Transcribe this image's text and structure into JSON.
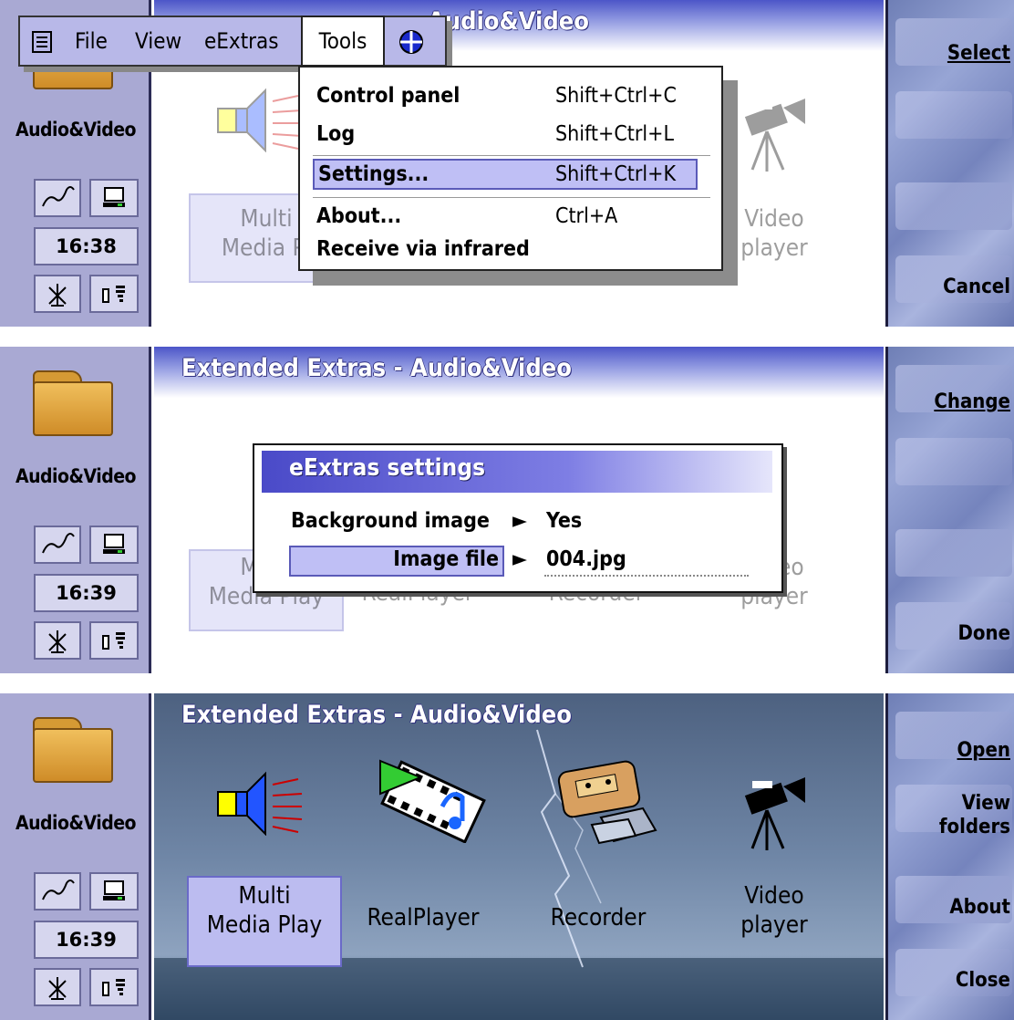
{
  "panels": [
    {
      "left": {
        "location": "Audio&Video",
        "time": "16:38",
        "link_icon": "cable-icon",
        "pc_icon": "computer-icon",
        "signal_icon": "no-signal-icon",
        "battery_icon": "battery-icon"
      },
      "title": "Audio&Video",
      "apps": [
        {
          "label1": "Multi",
          "label2": "Media Pl",
          "icon": "speaker-icon"
        },
        {
          "label1": "Video",
          "label2": "player",
          "icon": "video-camera-icon"
        }
      ],
      "menubar": {
        "items": [
          "File",
          "View",
          "eExtras",
          "Tools"
        ],
        "active": "Tools",
        "app_icon": "list-icon",
        "extra_icon": "web-icon"
      },
      "dropdown": [
        {
          "name": "Control panel",
          "shortcut": "Shift+Ctrl+C"
        },
        {
          "name": "Log",
          "shortcut": "Shift+Ctrl+L"
        },
        {
          "name": "Settings...",
          "shortcut": "Shift+Ctrl+K",
          "highlighted": true
        },
        {
          "name": "About...",
          "shortcut": "Ctrl+A"
        },
        {
          "name": "Receive via infrared",
          "shortcut": ""
        }
      ],
      "buttons": [
        "Select",
        "Cancel"
      ]
    },
    {
      "left": {
        "location": "Audio&Video",
        "time": "16:39"
      },
      "title": "Extended Extras - Audio&Video",
      "apps_visible": [
        "Multi",
        "Media Play",
        "RealPlayer",
        "Recorder",
        "Video",
        "player"
      ],
      "dialog": {
        "title": "eExtras settings",
        "rows": [
          {
            "label": "Background image",
            "value": "Yes"
          },
          {
            "label": "Image file",
            "value": "004.jpg",
            "highlighted": true
          }
        ]
      },
      "buttons": [
        "Change",
        "Done"
      ]
    },
    {
      "left": {
        "location": "Audio&Video",
        "time": "16:39"
      },
      "title": "Extended Extras - Audio&Video",
      "apps": [
        {
          "label1": "Multi",
          "label2": "Media Play",
          "icon": "speaker-icon",
          "selected": true
        },
        {
          "label1": "RealPlayer",
          "label2": "",
          "icon": "realplayer-icon"
        },
        {
          "label1": "Recorder",
          "label2": "",
          "icon": "cassette-recorder-icon"
        },
        {
          "label1": "Video",
          "label2": "player",
          "icon": "video-camera-icon"
        }
      ],
      "buttons": [
        "Open",
        "View folders",
        "About",
        "Close"
      ]
    }
  ]
}
